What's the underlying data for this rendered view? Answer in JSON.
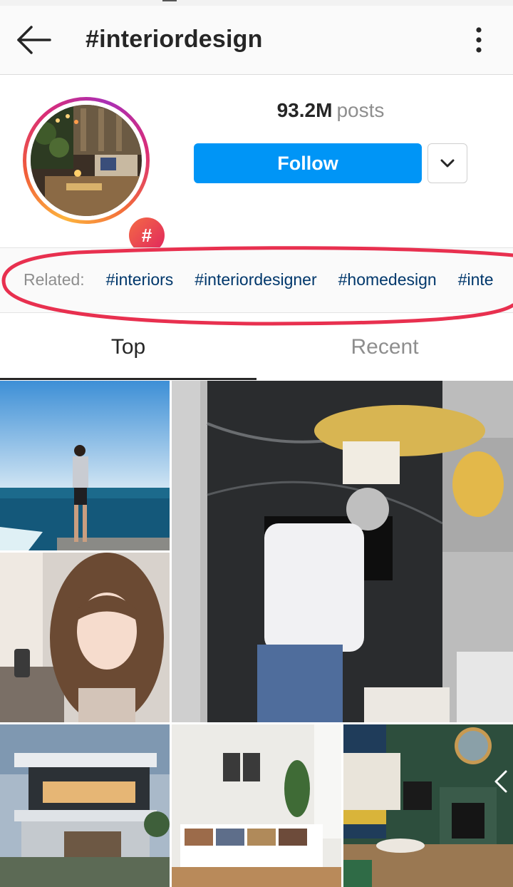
{
  "header": {
    "title": "#interiordesign"
  },
  "profile": {
    "posts_count": "93.2M",
    "posts_label": "posts",
    "badge_symbol": "#",
    "follow_label": "Follow"
  },
  "related": {
    "label": "Related:",
    "tags": [
      "#interiors",
      "#interiordesigner",
      "#homedesign",
      "#inte"
    ]
  },
  "tabs": [
    {
      "label": "Top",
      "selected": true
    },
    {
      "label": "Recent",
      "selected": false
    }
  ],
  "grid": {
    "posts": [
      {
        "subject": "man standing by the sea under blue sky"
      },
      {
        "subject": "selfie of woman with long brown hair"
      },
      {
        "subject": "man arranging marble table in front of black marble fireplace wall with gold chandelier"
      },
      {
        "subject": "modern white house with trees at dusk"
      },
      {
        "subject": "white living room with long bookshelf and plants"
      },
      {
        "subject": "living room with green fireplace wall and round mirror"
      }
    ]
  },
  "colors": {
    "follow_blue": "#0095f6",
    "related_tag": "#00376b",
    "muted_text": "#8e8e8e",
    "annotation_red": "#e8304f"
  }
}
